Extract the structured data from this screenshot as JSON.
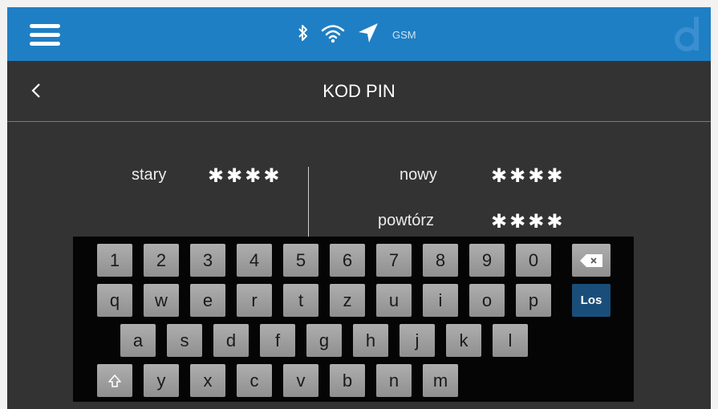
{
  "statusbar": {
    "network_label": "GSM",
    "icons": [
      "menu-icon",
      "bluetooth-icon",
      "wifi-icon",
      "location-icon",
      "logo-icon"
    ],
    "colors": {
      "bar": "#1f7fc4"
    }
  },
  "header": {
    "title": "KOD PIN",
    "back_icon": "chevron-left-icon"
  },
  "pin": {
    "old_label": "stary",
    "old_value": "✱✱✱✱",
    "new_label": "nowy",
    "new_value": "✱✱✱✱",
    "repeat_label": "powtórz",
    "repeat_value": "✱✱✱✱"
  },
  "keyboard": {
    "row1": [
      "1",
      "2",
      "3",
      "4",
      "5",
      "6",
      "7",
      "8",
      "9",
      "0"
    ],
    "row2": [
      "q",
      "w",
      "e",
      "r",
      "t",
      "z",
      "u",
      "i",
      "o",
      "p"
    ],
    "row3": [
      "a",
      "s",
      "d",
      "f",
      "g",
      "h",
      "j",
      "k",
      "l"
    ],
    "row4": [
      "y",
      "x",
      "c",
      "v",
      "b",
      "n",
      "m"
    ],
    "enter_label": "Los",
    "backspace_icon": "backspace-icon",
    "shift_icon": "shift-icon",
    "colors": {
      "key": "#a0a0a0",
      "enter": "#1a4e7a"
    }
  }
}
